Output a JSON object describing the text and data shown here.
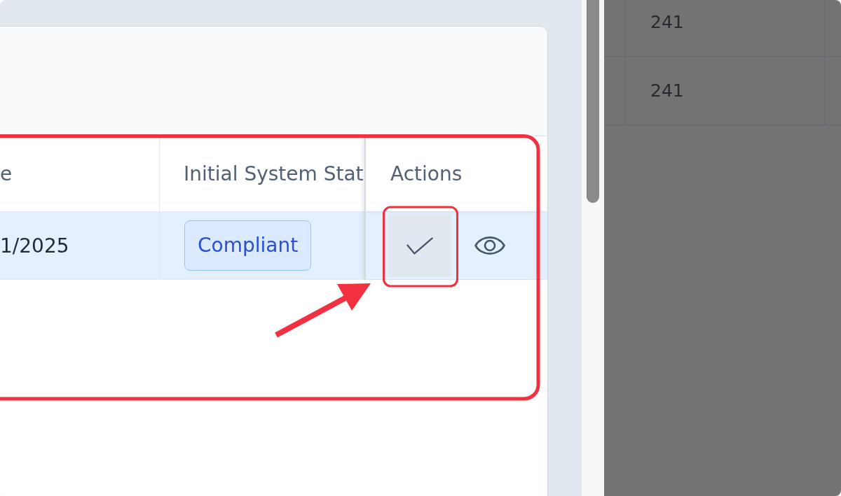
{
  "drawer": {
    "table": {
      "columns": [
        {
          "label": "e"
        },
        {
          "label": "Initial System Stat"
        },
        {
          "label": "Actions"
        }
      ],
      "rows": [
        {
          "highlighted": true,
          "column_1": "1/2025",
          "status": "Compliant",
          "actions": [
            {
              "kind": "check",
              "hovered": true
            },
            {
              "kind": "view",
              "hovered": false
            }
          ]
        }
      ]
    }
  },
  "background_table": {
    "rows": [
      {
        "column_2": "241"
      },
      {
        "column_2": "241"
      }
    ]
  }
}
